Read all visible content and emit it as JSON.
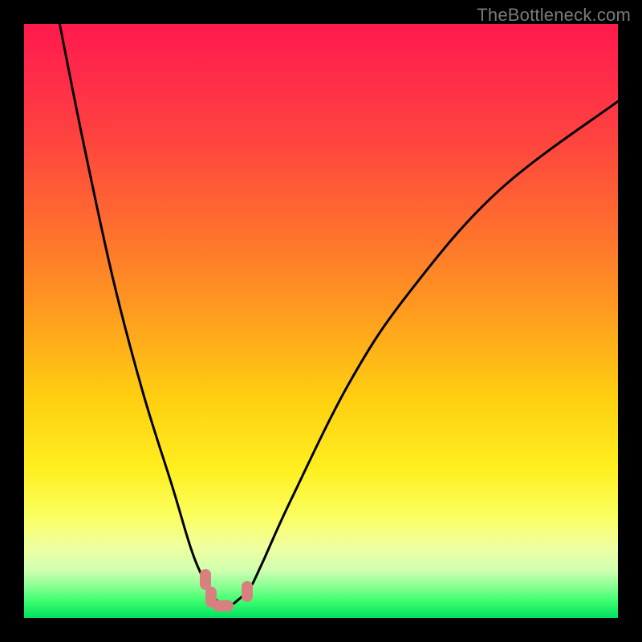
{
  "watermark": "TheBottleneck.com",
  "chart_data": {
    "type": "line",
    "title": "",
    "xlabel": "",
    "ylabel": "",
    "xlim": [
      0,
      100
    ],
    "ylim": [
      0,
      100
    ],
    "grid": false,
    "legend": false,
    "series": [
      {
        "name": "curve",
        "x": [
          6,
          10,
          15,
          20,
          25,
          28,
          30,
          32,
          33,
          34,
          35,
          36,
          38,
          40,
          45,
          55,
          65,
          80,
          100
        ],
        "y": [
          100,
          80,
          57,
          38,
          22,
          12,
          7,
          3.5,
          2.5,
          2.2,
          2.3,
          3,
          5,
          9,
          20,
          40,
          55,
          72,
          87
        ]
      }
    ],
    "markers": [
      {
        "shape": "v-capsule",
        "x": 30.5,
        "y": 6.5
      },
      {
        "shape": "v-capsule",
        "x": 31.5,
        "y": 3.5
      },
      {
        "shape": "h-capsule",
        "x": 33.5,
        "y": 2.0
      },
      {
        "shape": "v-capsule",
        "x": 37.5,
        "y": 4.5
      }
    ],
    "background_gradient": {
      "top": "#ff1a4d",
      "bottom": "#00e060",
      "stops": [
        "red",
        "orange",
        "yellow",
        "green"
      ]
    }
  }
}
